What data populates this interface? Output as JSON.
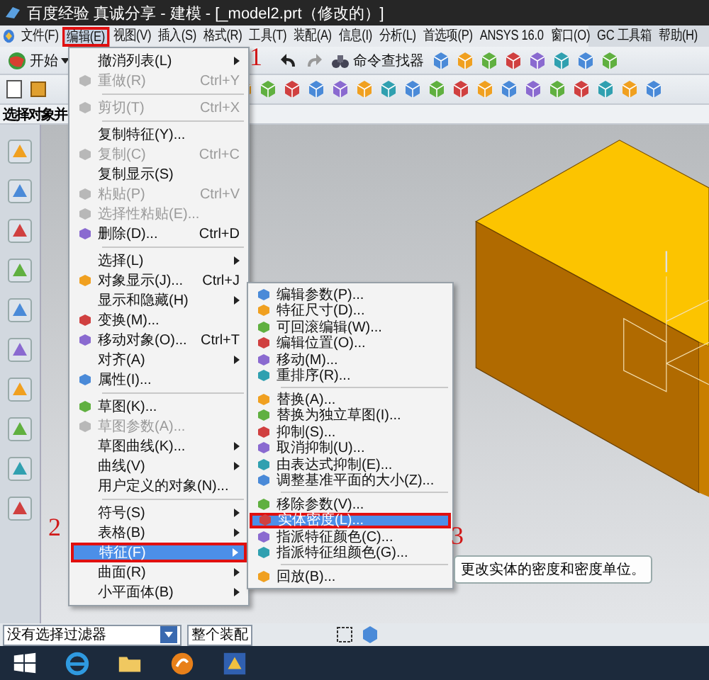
{
  "window": {
    "title": "百度经验   真诚分享 - 建模 - [_model2.prt（修改的）]"
  },
  "menu_bar": [
    {
      "label": "文件(F)",
      "selected": false,
      "annotated": false
    },
    {
      "label": "编辑(E)",
      "selected": true,
      "annotated": true
    },
    {
      "label": "视图(V)",
      "selected": false,
      "annotated": false
    },
    {
      "label": "插入(S)",
      "selected": false,
      "annotated": false
    },
    {
      "label": "格式(R)",
      "selected": false,
      "annotated": false
    },
    {
      "label": "工具(T)",
      "selected": false,
      "annotated": false
    },
    {
      "label": "装配(A)",
      "selected": false,
      "annotated": false
    },
    {
      "label": "信息(I)",
      "selected": false,
      "annotated": false
    },
    {
      "label": "分析(L)",
      "selected": false,
      "annotated": false
    },
    {
      "label": "首选项(P)",
      "selected": false,
      "annotated": false
    },
    {
      "label": "ANSYS 16.0",
      "selected": false,
      "annotated": false
    },
    {
      "label": "窗口(O)",
      "selected": false,
      "annotated": false
    },
    {
      "label": "GC 工具箱",
      "selected": false,
      "annotated": false
    },
    {
      "label": "帮助(H)",
      "selected": false,
      "annotated": false
    }
  ],
  "toolbar": {
    "start_label": "开始",
    "command_finder_label": "命令查找器"
  },
  "selection_bar": {
    "prompt": "选择对象并"
  },
  "edit_menu": {
    "items": [
      {
        "kind": "item",
        "label": "撤消列表(L)",
        "disabled": false,
        "selected": false,
        "has_icon": false,
        "has_submenu": true,
        "annotated": false
      },
      {
        "kind": "item",
        "label": "重做(R)",
        "shortcut": "Ctrl+Y",
        "disabled": true,
        "selected": false,
        "has_icon": true,
        "has_submenu": false,
        "annotated": false
      },
      {
        "kind": "separator"
      },
      {
        "kind": "item",
        "label": "剪切(T)",
        "shortcut": "Ctrl+X",
        "disabled": true,
        "selected": false,
        "has_icon": true,
        "has_submenu": false,
        "annotated": false
      },
      {
        "kind": "separator"
      },
      {
        "kind": "item",
        "label": "复制特征(Y)...",
        "disabled": false,
        "selected": false,
        "has_icon": false,
        "has_submenu": false,
        "annotated": false
      },
      {
        "kind": "item",
        "label": "复制(C)",
        "shortcut": "Ctrl+C",
        "disabled": true,
        "selected": false,
        "has_icon": true,
        "has_submenu": false,
        "annotated": false
      },
      {
        "kind": "item",
        "label": "复制显示(S)",
        "disabled": false,
        "selected": false,
        "has_icon": false,
        "has_submenu": false,
        "annotated": false
      },
      {
        "kind": "item",
        "label": "粘贴(P)",
        "shortcut": "Ctrl+V",
        "disabled": true,
        "selected": false,
        "has_icon": true,
        "has_submenu": false,
        "annotated": false
      },
      {
        "kind": "item",
        "label": "选择性粘贴(E)...",
        "disabled": true,
        "selected": false,
        "has_icon": true,
        "has_submenu": false,
        "annotated": false
      },
      {
        "kind": "item",
        "label": "删除(D)...",
        "shortcut": "Ctrl+D",
        "disabled": false,
        "selected": false,
        "has_icon": true,
        "has_submenu": false,
        "annotated": false
      },
      {
        "kind": "separator"
      },
      {
        "kind": "item",
        "label": "选择(L)",
        "disabled": false,
        "selected": false,
        "has_icon": false,
        "has_submenu": true,
        "annotated": false
      },
      {
        "kind": "item",
        "label": "对象显示(J)...",
        "shortcut": "Ctrl+J",
        "disabled": false,
        "selected": false,
        "has_icon": true,
        "has_submenu": false,
        "annotated": false
      },
      {
        "kind": "item",
        "label": "显示和隐藏(H)",
        "disabled": false,
        "selected": false,
        "has_icon": false,
        "has_submenu": true,
        "annotated": false
      },
      {
        "kind": "item",
        "label": "变换(M)...",
        "disabled": false,
        "selected": false,
        "has_icon": true,
        "has_submenu": false,
        "annotated": false
      },
      {
        "kind": "item",
        "label": "移动对象(O)...",
        "shortcut": "Ctrl+T",
        "disabled": false,
        "selected": false,
        "has_icon": true,
        "has_submenu": false,
        "annotated": false
      },
      {
        "kind": "item",
        "label": "对齐(A)",
        "disabled": false,
        "selected": false,
        "has_icon": false,
        "has_submenu": true,
        "annotated": false
      },
      {
        "kind": "item",
        "label": "属性(I)...",
        "disabled": false,
        "selected": false,
        "has_icon": true,
        "has_submenu": false,
        "annotated": false
      },
      {
        "kind": "separator"
      },
      {
        "kind": "item",
        "label": "草图(K)...",
        "disabled": false,
        "selected": false,
        "has_icon": true,
        "has_submenu": false,
        "annotated": false
      },
      {
        "kind": "item",
        "label": "草图参数(A)...",
        "disabled": true,
        "selected": false,
        "has_icon": true,
        "has_submenu": false,
        "annotated": false
      },
      {
        "kind": "item",
        "label": "草图曲线(K)...",
        "disabled": false,
        "selected": false,
        "has_icon": false,
        "has_submenu": true,
        "annotated": false
      },
      {
        "kind": "item",
        "label": "曲线(V)",
        "disabled": false,
        "selected": false,
        "has_icon": false,
        "has_submenu": true,
        "annotated": false
      },
      {
        "kind": "item",
        "label": "用户定义的对象(N)...",
        "disabled": false,
        "selected": false,
        "has_icon": false,
        "has_submenu": false,
        "annotated": false
      },
      {
        "kind": "separator"
      },
      {
        "kind": "item",
        "label": "符号(S)",
        "disabled": false,
        "selected": false,
        "has_icon": false,
        "has_submenu": true,
        "annotated": false
      },
      {
        "kind": "item",
        "label": "表格(B)",
        "disabled": false,
        "selected": false,
        "has_icon": false,
        "has_submenu": true,
        "annotated": false
      },
      {
        "kind": "item",
        "label": "特征(F)",
        "disabled": false,
        "selected": true,
        "has_icon": false,
        "has_submenu": true,
        "annotated": true
      },
      {
        "kind": "item",
        "label": "曲面(R)",
        "disabled": false,
        "selected": false,
        "has_icon": false,
        "has_submenu": true,
        "annotated": false
      },
      {
        "kind": "item",
        "label": "小平面体(B)",
        "disabled": false,
        "selected": false,
        "has_icon": false,
        "has_submenu": true,
        "annotated": false
      }
    ]
  },
  "feature_submenu": {
    "items": [
      {
        "kind": "item",
        "label": "编辑参数(P)...",
        "selected": false,
        "annotated": false
      },
      {
        "kind": "item",
        "label": "特征尺寸(D)...",
        "selected": false,
        "annotated": false
      },
      {
        "kind": "item",
        "label": "可回滚编辑(W)...",
        "selected": false,
        "annotated": false
      },
      {
        "kind": "item",
        "label": "编辑位置(O)...",
        "selected": false,
        "annotated": false
      },
      {
        "kind": "item",
        "label": "移动(M)...",
        "selected": false,
        "annotated": false
      },
      {
        "kind": "item",
        "label": "重排序(R)...",
        "selected": false,
        "annotated": false
      },
      {
        "kind": "separator"
      },
      {
        "kind": "item",
        "label": "替换(A)...",
        "selected": false,
        "annotated": false
      },
      {
        "kind": "item",
        "label": "替换为独立草图(I)...",
        "selected": false,
        "annotated": false
      },
      {
        "kind": "item",
        "label": "抑制(S)...",
        "selected": false,
        "annotated": false
      },
      {
        "kind": "item",
        "label": "取消抑制(U)...",
        "selected": false,
        "annotated": false
      },
      {
        "kind": "item",
        "label": "由表达式抑制(E)...",
        "selected": false,
        "annotated": false
      },
      {
        "kind": "item",
        "label": "调整基准平面的大小(Z)...",
        "selected": false,
        "annotated": false
      },
      {
        "kind": "separator"
      },
      {
        "kind": "item",
        "label": "移除参数(V)...",
        "selected": false,
        "annotated": false
      },
      {
        "kind": "item",
        "label": "实体密度(L)...",
        "selected": true,
        "annotated": true
      },
      {
        "kind": "item",
        "label": "指派特征颜色(C)...",
        "selected": false,
        "annotated": false
      },
      {
        "kind": "item",
        "label": "指派特征组颜色(G)...",
        "selected": false,
        "annotated": false
      },
      {
        "kind": "separator"
      },
      {
        "kind": "item",
        "label": "回放(B)...",
        "selected": false,
        "annotated": false
      }
    ]
  },
  "tooltip": {
    "text": "更改实体的密度和密度单位。"
  },
  "status_bar": {
    "filter": "没有选择过滤器",
    "scope": "整个装配"
  },
  "annotations": [
    {
      "label": "1"
    },
    {
      "label": "2"
    },
    {
      "label": "3"
    }
  ]
}
